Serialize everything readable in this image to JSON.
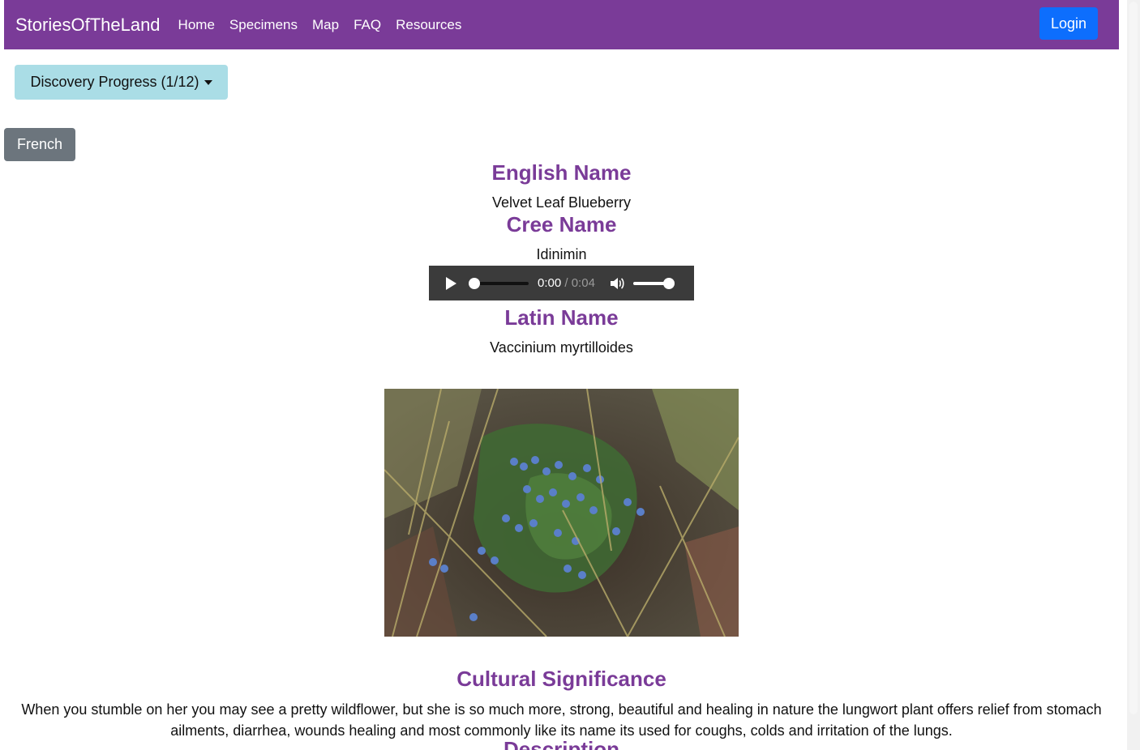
{
  "navbar": {
    "brand": "StoriesOfTheLand",
    "links": [
      "Home",
      "Specimens",
      "Map",
      "FAQ",
      "Resources"
    ],
    "login_label": "Login"
  },
  "progress": {
    "label": "Discovery Progress (1/12)"
  },
  "language_button": "French",
  "specimen": {
    "english_heading": "English Name",
    "english_name": "Velvet Leaf Blueberry",
    "cree_heading": "Cree Name",
    "cree_name": "Idinimin",
    "audio": {
      "current_time": "0:00",
      "duration": "0:04",
      "progress": 0.0,
      "volume": 1.0
    },
    "latin_heading": "Latin Name",
    "latin_name": "Vaccinium myrtilloides",
    "image_subject": "blueberry-plant-photo",
    "cultural_heading": "Cultural Significance",
    "cultural_text": "When you stumble on her you may see a pretty wildflower, but she is so much more, strong, beautiful and healing in nature the lungwort plant offers relief from stomach ailments, diarrhea, wounds healing and most commonly like its name its used for coughs, colds and irritation of the lungs.",
    "description_heading": "Description"
  },
  "colors": {
    "brand_purple": "#7a3b98",
    "login_blue": "#0d6efd",
    "progress_teal": "#aadde6",
    "secondary_gray": "#6c757d"
  }
}
